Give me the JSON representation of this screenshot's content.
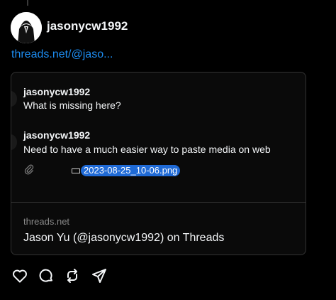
{
  "post": {
    "username": "jasonycw1992",
    "link_text": "threads.net/@jaso..."
  },
  "quoted": {
    "posts": [
      {
        "username": "jasonycw1992",
        "text": "What is missing here?"
      },
      {
        "username": "jasonycw1992",
        "text": "Need to have a much easier way to paste media on web"
      }
    ],
    "attachment_name": "2023-08-25_10-06.png",
    "domain": "threads.net",
    "title": "Jason Yu (@jasonycw1992) on Threads"
  },
  "icons": [
    "heart-icon",
    "comment-icon",
    "repost-icon",
    "share-icon",
    "paperclip-icon"
  ]
}
